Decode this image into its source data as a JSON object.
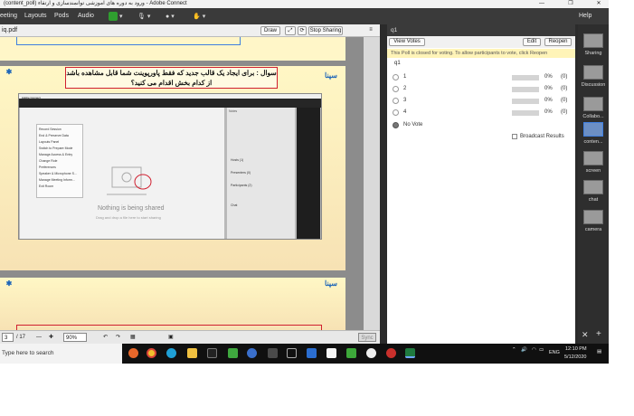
{
  "titlebar": {
    "title": "(content_poll) ورود به دوره های آموزشی توانمندسازی و ارتقاء - Adobe Connect",
    "minimize": "—",
    "restore": "❐",
    "close": "✕"
  },
  "menu": {
    "meeting": "eeting",
    "layouts": "Layouts",
    "pods": "Pods",
    "audio": "Audio",
    "help": "Help"
  },
  "share": {
    "file_name": "iq.pdf",
    "draw_label": "Draw",
    "stop_sharing_label": "Stop Sharing",
    "question_text": "سوال : برای ایجاد یک قالب جدید که فقط پاورپوینت شما قابل مشاهده باشد از کدام بخش اقدام می کنید؟",
    "logo_text": "سپنا",
    "nested": {
      "title": "Adobe Connect",
      "menu_items": [
        "Record Session",
        "End & Preserve Data",
        "Layouts Panel",
        "Switch to Prepare Mode",
        "Manage Access & Entry",
        "Change Role",
        "Preferences",
        "Speaker & Microphone S...",
        "Manage Meeting Inform...",
        "Exit Room"
      ],
      "empty_title": "Nothing is being shared",
      "empty_sub": "Drag and drop a file here to start sharing",
      "side_header": "Notes",
      "side_items": [
        "Hosts (1)",
        "Presenters (0)",
        "Participants (2)"
      ],
      "chat_header": "Chat"
    }
  },
  "pager": {
    "page": "3",
    "total": "/ 17",
    "zoom": "90%",
    "sync": "Sync"
  },
  "poll": {
    "title": "q1",
    "view_votes": "View Votes",
    "edit": "Edit",
    "reopen": "Reopen",
    "notice": "This Poll is closed for voting. To allow participants to vote, click Reopen",
    "question": "q1",
    "options": [
      {
        "label": "1",
        "pct": "0%",
        "count": "(0)"
      },
      {
        "label": "2",
        "pct": "0%",
        "count": "(0)"
      },
      {
        "label": "3",
        "pct": "0%",
        "count": "(0)"
      },
      {
        "label": "4",
        "pct": "0%",
        "count": "(0)"
      }
    ],
    "no_vote": "No Vote",
    "broadcast": "Broadcast Results"
  },
  "layouts": [
    "Sharing",
    "Discussion",
    "Collabo...",
    "conten...",
    "screen",
    "chat",
    "camera"
  ],
  "taskbar": {
    "search": "Type here to search",
    "lang": "ENG",
    "time": "12:10 PM",
    "date": "5/12/2020"
  },
  "colors": {
    "accent": "#3f7fe0",
    "slide_bg": "#fff7c5",
    "question_border": "#d02030",
    "poll_notice": "#fff4b8"
  }
}
